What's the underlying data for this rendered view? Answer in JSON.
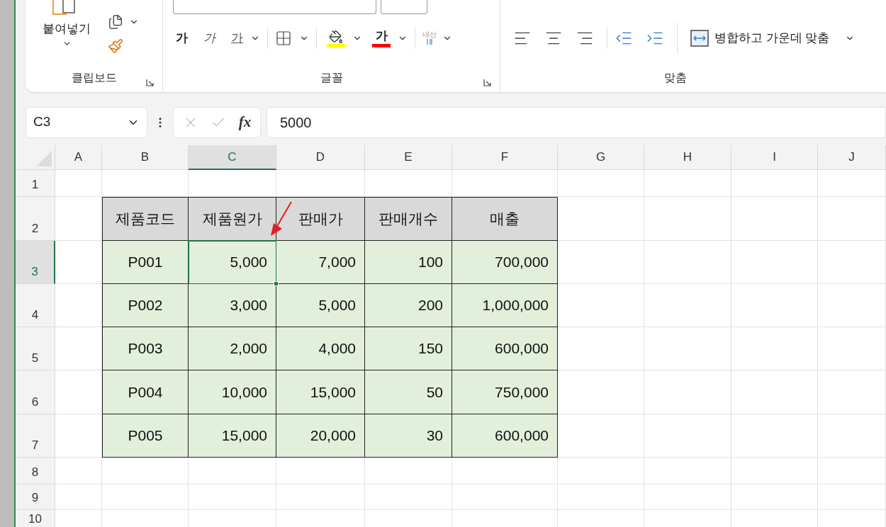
{
  "ribbon": {
    "paste_label": "붙여넣기",
    "bold": "가",
    "italic": "가",
    "underline": "가",
    "font_color": "가",
    "phonetic": "내선",
    "merge_label": "병합하고 가운데 맞춤",
    "groups": [
      {
        "label": "클립보드"
      },
      {
        "label": "글꼴"
      },
      {
        "label": "맞춤"
      }
    ]
  },
  "formula_bar": {
    "name_box": "C3",
    "fx": "fx",
    "value": "5000"
  },
  "columns": [
    {
      "label": "A",
      "selected": false
    },
    {
      "label": "B",
      "selected": false
    },
    {
      "label": "C",
      "selected": true
    },
    {
      "label": "D",
      "selected": false
    },
    {
      "label": "E",
      "selected": false
    },
    {
      "label": "F",
      "selected": false
    },
    {
      "label": "G",
      "selected": false
    },
    {
      "label": "H",
      "selected": false
    },
    {
      "label": "I",
      "selected": false
    },
    {
      "label": "J",
      "selected": false
    }
  ],
  "rows": [
    {
      "label": "1",
      "selected": false
    },
    {
      "label": "2",
      "selected": false
    },
    {
      "label": "3",
      "selected": true
    },
    {
      "label": "4",
      "selected": false
    },
    {
      "label": "5",
      "selected": false
    },
    {
      "label": "6",
      "selected": false
    },
    {
      "label": "7",
      "selected": false
    },
    {
      "label": "8",
      "selected": false
    },
    {
      "label": "9",
      "selected": false
    },
    {
      "label": "10",
      "selected": false
    }
  ],
  "table": {
    "headers": [
      "제품코드",
      "제품원가",
      "판매가",
      "판매개수",
      "매출"
    ],
    "rows": [
      {
        "cells": [
          {
            "text": "P001",
            "selected": false
          },
          {
            "text": "5,000",
            "selected": true
          },
          {
            "text": "7,000",
            "selected": false
          },
          {
            "text": "100",
            "selected": false
          },
          {
            "text": "700,000",
            "selected": false
          }
        ]
      },
      {
        "cells": [
          {
            "text": "P002",
            "selected": false
          },
          {
            "text": "3,000",
            "selected": false
          },
          {
            "text": "5,000",
            "selected": false
          },
          {
            "text": "200",
            "selected": false
          },
          {
            "text": "1,000,000",
            "selected": false
          }
        ]
      },
      {
        "cells": [
          {
            "text": "P003",
            "selected": false
          },
          {
            "text": "2,000",
            "selected": false
          },
          {
            "text": "4,000",
            "selected": false
          },
          {
            "text": "150",
            "selected": false
          },
          {
            "text": "600,000",
            "selected": false
          }
        ]
      },
      {
        "cells": [
          {
            "text": "P004",
            "selected": false
          },
          {
            "text": "10,000",
            "selected": false
          },
          {
            "text": "15,000",
            "selected": false
          },
          {
            "text": "50",
            "selected": false
          },
          {
            "text": "750,000",
            "selected": false
          }
        ]
      },
      {
        "cells": [
          {
            "text": "P005",
            "selected": false
          },
          {
            "text": "15,000",
            "selected": false
          },
          {
            "text": "20,000",
            "selected": false
          },
          {
            "text": "30",
            "selected": false
          },
          {
            "text": "600,000",
            "selected": false
          }
        ]
      }
    ]
  }
}
